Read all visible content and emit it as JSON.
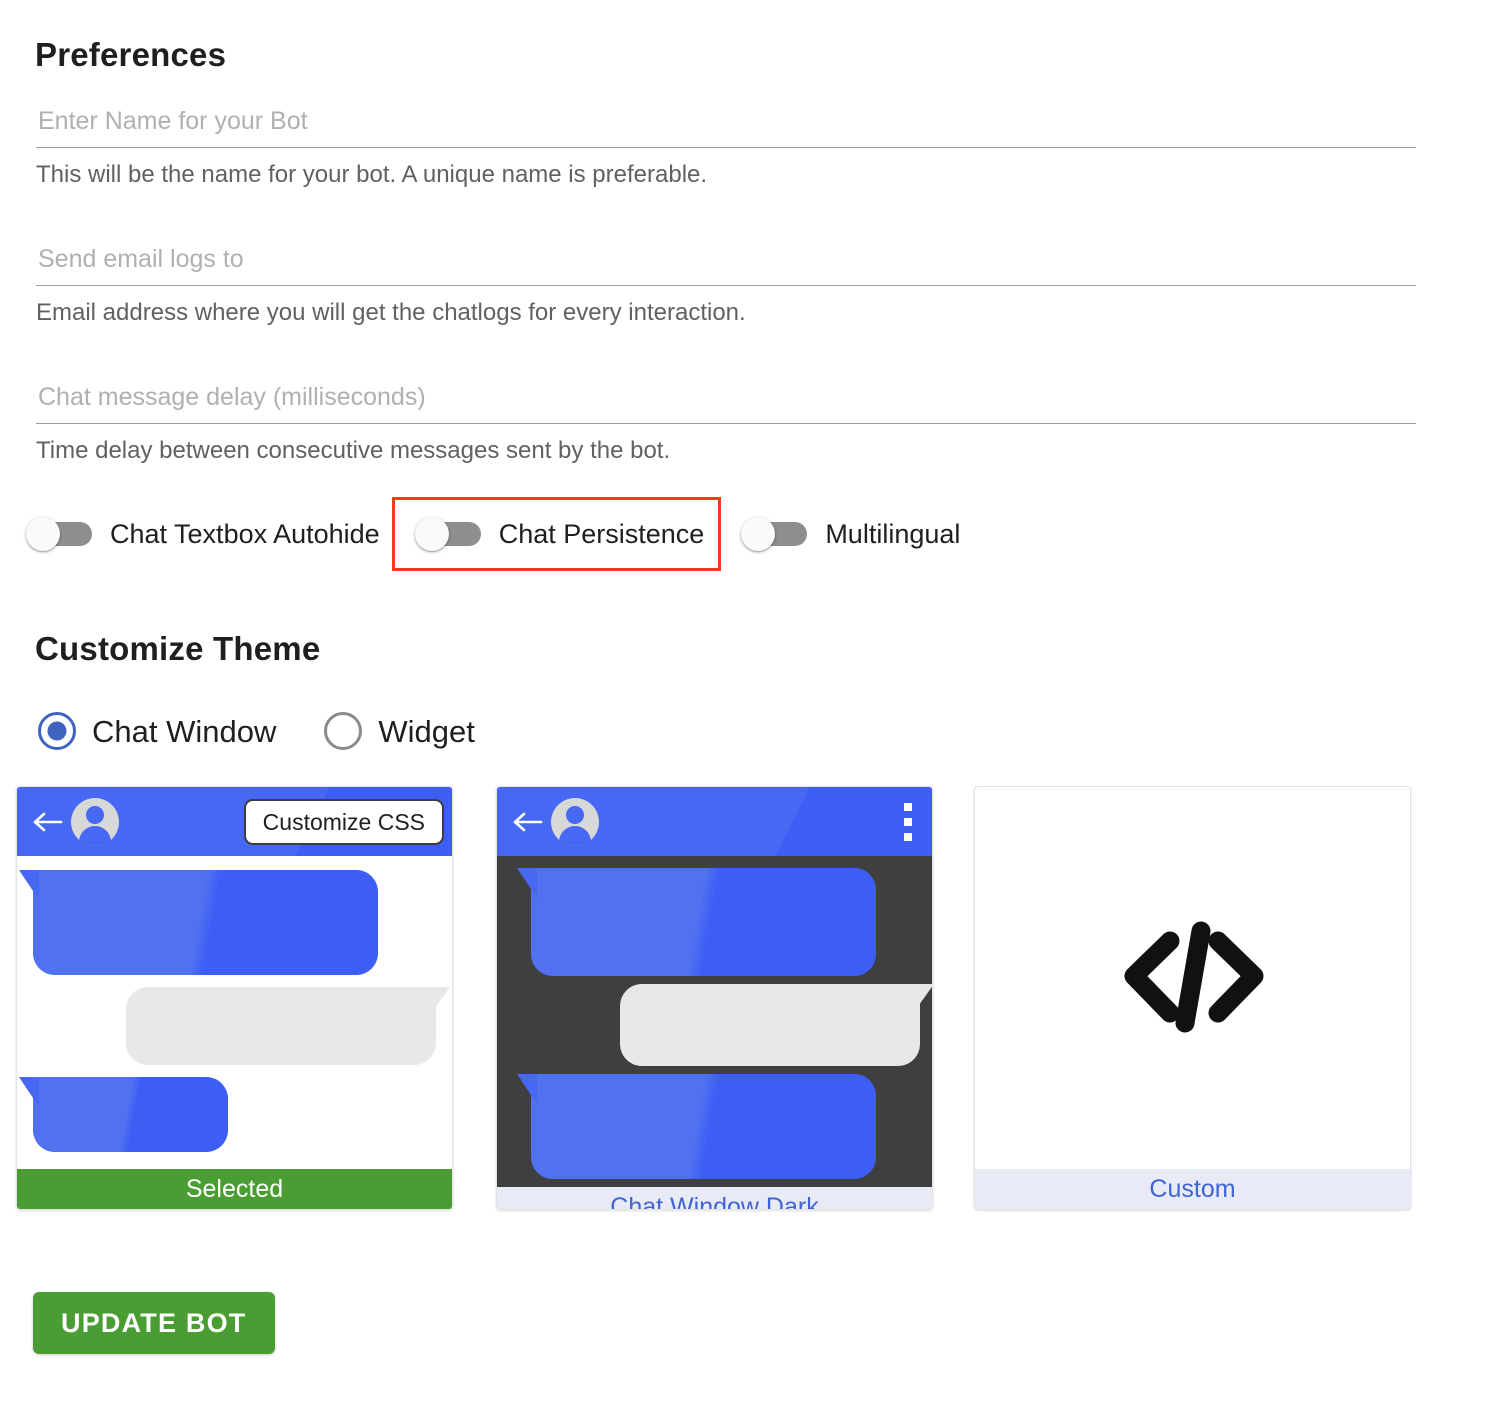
{
  "preferences": {
    "title": "Preferences",
    "fields": [
      {
        "name": "bot-name",
        "placeholder": "Enter Name for your Bot",
        "value": "",
        "hint": "This will be the name for your bot. A unique name is preferable."
      },
      {
        "name": "email-logs",
        "placeholder": "Send email logs to",
        "value": "",
        "hint": "Email address where you will get the chatlogs for every interaction."
      },
      {
        "name": "chat-message-delay",
        "placeholder": "Chat message delay (milliseconds)",
        "value": "",
        "hint": "Time delay between consecutive messages sent by the bot."
      }
    ],
    "toggles": [
      {
        "name": "chat-textbox-autohide",
        "label": "Chat Textbox Autohide",
        "checked": false,
        "highlighted": false
      },
      {
        "name": "chat-persistence",
        "label": "Chat Persistence",
        "checked": false,
        "highlighted": true
      },
      {
        "name": "multilingual",
        "label": "Multilingual",
        "checked": false,
        "highlighted": false
      }
    ]
  },
  "customize_theme": {
    "title": "Customize Theme",
    "radios": [
      {
        "name": "chat-window",
        "label": "Chat Window",
        "checked": true
      },
      {
        "name": "widget",
        "label": "Widget",
        "checked": false
      }
    ],
    "cards": [
      {
        "name": "chat-window",
        "footer_label": "Selected",
        "footer_state": "selected",
        "overlay_button": "Customize CSS",
        "style": "light",
        "header_icon": "back-arrow-icon",
        "menu_icon": null
      },
      {
        "name": "chat-window-dark",
        "footer_label": "Chat Window Dark",
        "footer_state": "link",
        "overlay_button": null,
        "style": "dark",
        "header_icon": "back-arrow-icon",
        "menu_icon": "kebab-menu-icon"
      },
      {
        "name": "custom",
        "footer_label": "Custom",
        "footer_state": "link",
        "overlay_button": null,
        "style": "custom",
        "body_icon": "code-icon"
      }
    ]
  },
  "actions": {
    "update_bot": "UPDATE BOT"
  },
  "colors": {
    "accent_blue": "#4668f2",
    "accent_blue_dark": "#3d5ef5",
    "green": "#4a9d32",
    "highlight_red": "#f4391c",
    "dark_card_bg": "#3f3f3f",
    "footer_link_bg": "#e8eaf6",
    "footer_link_text": "#3f64d8"
  }
}
